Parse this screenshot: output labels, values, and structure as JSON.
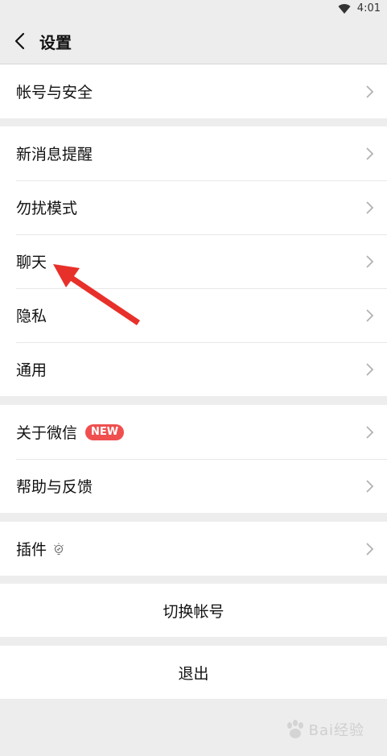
{
  "status_bar": {
    "time": "4:01"
  },
  "header": {
    "title": "设置"
  },
  "groups": [
    {
      "items": [
        {
          "label": "帐号与安全"
        }
      ]
    },
    {
      "items": [
        {
          "label": "新消息提醒"
        },
        {
          "label": "勿扰模式"
        },
        {
          "label": "聊天"
        },
        {
          "label": "隐私"
        },
        {
          "label": "通用"
        }
      ]
    },
    {
      "items": [
        {
          "label": "关于微信",
          "badge": "NEW"
        },
        {
          "label": "帮助与反馈"
        }
      ]
    },
    {
      "items": [
        {
          "label": "插件"
        }
      ]
    }
  ],
  "actions": {
    "switch_account": "切换帐号",
    "logout": "退出"
  },
  "watermark": {
    "text": "Bai经验"
  },
  "colors": {
    "background": "#ededed",
    "badge": "#f04f4f",
    "annotation_arrow": "#e8302a"
  }
}
